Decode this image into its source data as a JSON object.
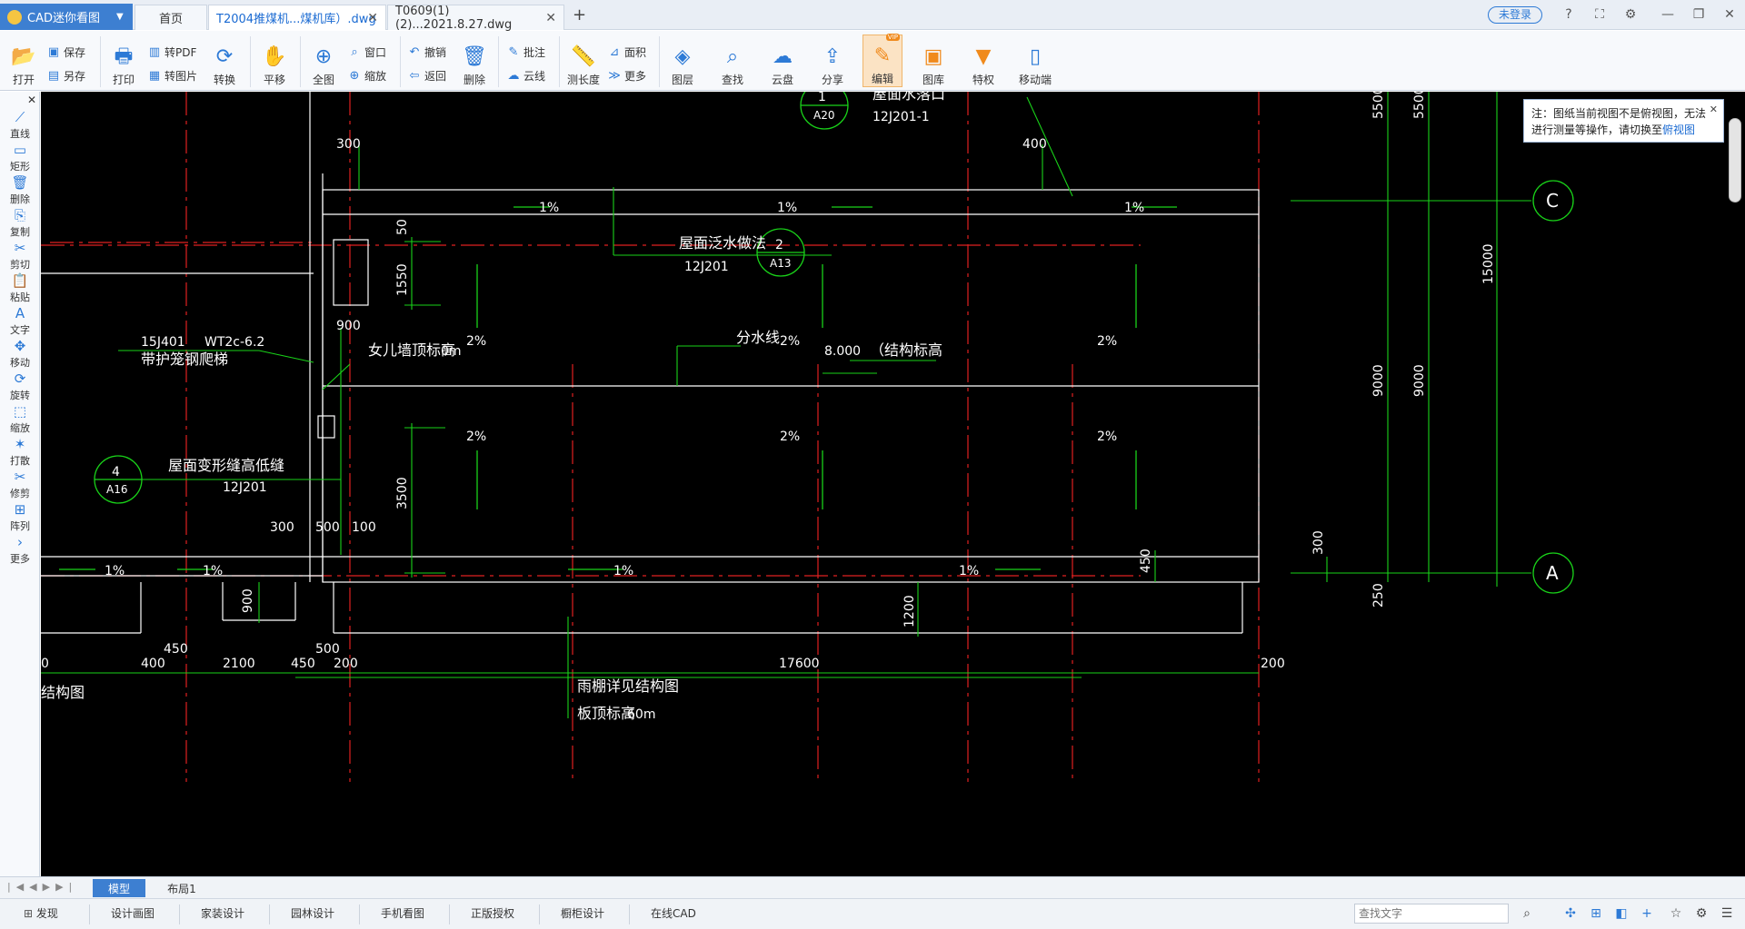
{
  "app": {
    "title": "CAD迷你看图",
    "login": "未登录"
  },
  "tabs": {
    "home": "首页",
    "doc1": "T2004推煤机...煤机库）.dwg",
    "doc2": "T0609(1)(2)...2021.8.27.dwg",
    "add": "+"
  },
  "toolbar": {
    "open": "打开",
    "save": "保存",
    "saveas": "另存",
    "print": "打印",
    "topdf": "转PDF",
    "toimg": "转图片",
    "convert": "转换",
    "pan": "平移",
    "fit": "全图",
    "window": "窗口",
    "zoom": "缩放",
    "undo": "撤销",
    "back": "返回",
    "delete": "删除",
    "annotate": "批注",
    "cloud_line": "云线",
    "measure": "测长度",
    "area": "面积",
    "more": "更多",
    "layers": "图层",
    "find": "查找",
    "cloud": "云盘",
    "share": "分享",
    "edit": "编辑",
    "edit_badge": "VIP",
    "library": "图库",
    "privilege": "特权",
    "mobile": "移动端"
  },
  "left_tools": [
    "直线",
    "矩形",
    "删除",
    "复制",
    "剪切",
    "粘贴",
    "文字",
    "移动",
    "旋转",
    "缩放",
    "打散",
    "修剪",
    "阵列",
    "更多"
  ],
  "notice": {
    "text": "注：图纸当前视图不是俯视图，无法进行测量等操作，请切换至",
    "link": "俯视图"
  },
  "layout_tabs": {
    "model": "模型",
    "layout1": "布局1"
  },
  "status": {
    "discover": "发现",
    "items": [
      "设计画图",
      "家装设计",
      "园林设计",
      "手机看图",
      "正版授权",
      "橱柜设计",
      "在线CAD"
    ],
    "search_placeholder": "查找文字"
  },
  "drawing": {
    "callout1_num": "1",
    "callout1_sheet": "A20",
    "callout1_title": "屋面水落口",
    "callout1_ref": "12J201-1",
    "callout2_num": "2",
    "callout2_sheet": "A13",
    "callout2_title": "屋面泛水做法",
    "callout2_ref": "12J201",
    "callout4_num": "4",
    "callout4_sheet": "A16",
    "callout4_title": "屋面变形缝高低缝",
    "callout4_ref": "12J201",
    "grid_c": "C",
    "grid_a": "A",
    "ladder_ref": "15J401",
    "ladder_code": "WT2c-6.2",
    "ladder_title": "带护笼钢爬梯",
    "parapet": "女儿墙顶标高",
    "parapet_suffix": "0m",
    "divide": "分水线",
    "elev": "8.000",
    "elev_note": "（结构标高",
    "canopy": "雨棚详见结构图",
    "slab": "板顶标高",
    "slab_suffix": "60m",
    "struct": "结构图",
    "slope1": "1%",
    "slope2": "2%",
    "dims": {
      "d300a": "300",
      "d400": "400",
      "d50": "50",
      "d1550": "1550",
      "d900a": "900",
      "d3500": "3500",
      "d300b": "300",
      "d500a": "500",
      "d100": "100",
      "d900b": "900",
      "d1200": "1200",
      "d450a": "450",
      "d300c": "300",
      "d250": "250",
      "d9000a": "9000",
      "d9000b": "9000",
      "d15000": "15000",
      "d5500a": "5500",
      "d5500b": "5500",
      "b0": "0",
      "b400": "400",
      "b450a": "450",
      "b2100": "2100",
      "b450b": "450",
      "b500": "500",
      "b200a": "200",
      "b17600": "17600",
      "b200b": "200"
    }
  }
}
